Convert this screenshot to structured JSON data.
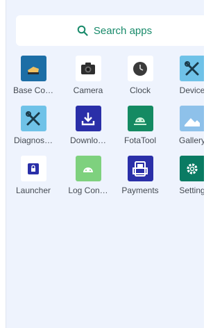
{
  "search": {
    "label": "Search apps"
  },
  "apps": [
    {
      "label": "Base Co…",
      "icon": "base-config-icon",
      "color": "#1c6ea6"
    },
    {
      "label": "Camera",
      "icon": "camera-icon",
      "color": "#ffffff"
    },
    {
      "label": "Clock",
      "icon": "clock-icon",
      "color": "#ffffff"
    },
    {
      "label": "Device",
      "icon": "device-tools-icon",
      "color": "#6fc2e8"
    },
    {
      "label": "Diagnos…",
      "icon": "diagnostics-icon",
      "color": "#6fc2e8"
    },
    {
      "label": "Downlo…",
      "icon": "download-icon",
      "color": "#2a2fa8"
    },
    {
      "label": "FotaTool",
      "icon": "fotatool-icon",
      "color": "#148a62"
    },
    {
      "label": "Gallery",
      "icon": "gallery-icon",
      "color": "#8ec1ea"
    },
    {
      "label": "Launcher",
      "icon": "launcher-icon",
      "color": "#ffffff"
    },
    {
      "label": "Log Con…",
      "icon": "log-config-icon",
      "color": "#7ed17e"
    },
    {
      "label": "Payments",
      "icon": "payments-icon",
      "color": "#2a2fa8"
    },
    {
      "label": "Setting",
      "icon": "settings-icon",
      "color": "#0a7b63"
    }
  ],
  "accent": "#188a6a"
}
